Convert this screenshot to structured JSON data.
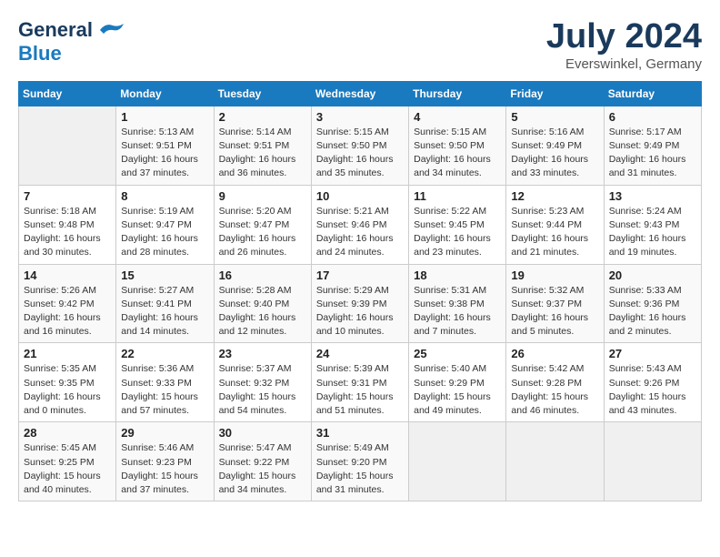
{
  "header": {
    "logo_general": "General",
    "logo_blue": "Blue",
    "month_title": "July 2024",
    "location": "Everswinkel, Germany"
  },
  "weekdays": [
    "Sunday",
    "Monday",
    "Tuesday",
    "Wednesday",
    "Thursday",
    "Friday",
    "Saturday"
  ],
  "weeks": [
    [
      {
        "day": "",
        "info": ""
      },
      {
        "day": "1",
        "info": "Sunrise: 5:13 AM\nSunset: 9:51 PM\nDaylight: 16 hours\nand 37 minutes."
      },
      {
        "day": "2",
        "info": "Sunrise: 5:14 AM\nSunset: 9:51 PM\nDaylight: 16 hours\nand 36 minutes."
      },
      {
        "day": "3",
        "info": "Sunrise: 5:15 AM\nSunset: 9:50 PM\nDaylight: 16 hours\nand 35 minutes."
      },
      {
        "day": "4",
        "info": "Sunrise: 5:15 AM\nSunset: 9:50 PM\nDaylight: 16 hours\nand 34 minutes."
      },
      {
        "day": "5",
        "info": "Sunrise: 5:16 AM\nSunset: 9:49 PM\nDaylight: 16 hours\nand 33 minutes."
      },
      {
        "day": "6",
        "info": "Sunrise: 5:17 AM\nSunset: 9:49 PM\nDaylight: 16 hours\nand 31 minutes."
      }
    ],
    [
      {
        "day": "7",
        "info": "Sunrise: 5:18 AM\nSunset: 9:48 PM\nDaylight: 16 hours\nand 30 minutes."
      },
      {
        "day": "8",
        "info": "Sunrise: 5:19 AM\nSunset: 9:47 PM\nDaylight: 16 hours\nand 28 minutes."
      },
      {
        "day": "9",
        "info": "Sunrise: 5:20 AM\nSunset: 9:47 PM\nDaylight: 16 hours\nand 26 minutes."
      },
      {
        "day": "10",
        "info": "Sunrise: 5:21 AM\nSunset: 9:46 PM\nDaylight: 16 hours\nand 24 minutes."
      },
      {
        "day": "11",
        "info": "Sunrise: 5:22 AM\nSunset: 9:45 PM\nDaylight: 16 hours\nand 23 minutes."
      },
      {
        "day": "12",
        "info": "Sunrise: 5:23 AM\nSunset: 9:44 PM\nDaylight: 16 hours\nand 21 minutes."
      },
      {
        "day": "13",
        "info": "Sunrise: 5:24 AM\nSunset: 9:43 PM\nDaylight: 16 hours\nand 19 minutes."
      }
    ],
    [
      {
        "day": "14",
        "info": "Sunrise: 5:26 AM\nSunset: 9:42 PM\nDaylight: 16 hours\nand 16 minutes."
      },
      {
        "day": "15",
        "info": "Sunrise: 5:27 AM\nSunset: 9:41 PM\nDaylight: 16 hours\nand 14 minutes."
      },
      {
        "day": "16",
        "info": "Sunrise: 5:28 AM\nSunset: 9:40 PM\nDaylight: 16 hours\nand 12 minutes."
      },
      {
        "day": "17",
        "info": "Sunrise: 5:29 AM\nSunset: 9:39 PM\nDaylight: 16 hours\nand 10 minutes."
      },
      {
        "day": "18",
        "info": "Sunrise: 5:31 AM\nSunset: 9:38 PM\nDaylight: 16 hours\nand 7 minutes."
      },
      {
        "day": "19",
        "info": "Sunrise: 5:32 AM\nSunset: 9:37 PM\nDaylight: 16 hours\nand 5 minutes."
      },
      {
        "day": "20",
        "info": "Sunrise: 5:33 AM\nSunset: 9:36 PM\nDaylight: 16 hours\nand 2 minutes."
      }
    ],
    [
      {
        "day": "21",
        "info": "Sunrise: 5:35 AM\nSunset: 9:35 PM\nDaylight: 16 hours\nand 0 minutes."
      },
      {
        "day": "22",
        "info": "Sunrise: 5:36 AM\nSunset: 9:33 PM\nDaylight: 15 hours\nand 57 minutes."
      },
      {
        "day": "23",
        "info": "Sunrise: 5:37 AM\nSunset: 9:32 PM\nDaylight: 15 hours\nand 54 minutes."
      },
      {
        "day": "24",
        "info": "Sunrise: 5:39 AM\nSunset: 9:31 PM\nDaylight: 15 hours\nand 51 minutes."
      },
      {
        "day": "25",
        "info": "Sunrise: 5:40 AM\nSunset: 9:29 PM\nDaylight: 15 hours\nand 49 minutes."
      },
      {
        "day": "26",
        "info": "Sunrise: 5:42 AM\nSunset: 9:28 PM\nDaylight: 15 hours\nand 46 minutes."
      },
      {
        "day": "27",
        "info": "Sunrise: 5:43 AM\nSunset: 9:26 PM\nDaylight: 15 hours\nand 43 minutes."
      }
    ],
    [
      {
        "day": "28",
        "info": "Sunrise: 5:45 AM\nSunset: 9:25 PM\nDaylight: 15 hours\nand 40 minutes."
      },
      {
        "day": "29",
        "info": "Sunrise: 5:46 AM\nSunset: 9:23 PM\nDaylight: 15 hours\nand 37 minutes."
      },
      {
        "day": "30",
        "info": "Sunrise: 5:47 AM\nSunset: 9:22 PM\nDaylight: 15 hours\nand 34 minutes."
      },
      {
        "day": "31",
        "info": "Sunrise: 5:49 AM\nSunset: 9:20 PM\nDaylight: 15 hours\nand 31 minutes."
      },
      {
        "day": "",
        "info": ""
      },
      {
        "day": "",
        "info": ""
      },
      {
        "day": "",
        "info": ""
      }
    ]
  ]
}
